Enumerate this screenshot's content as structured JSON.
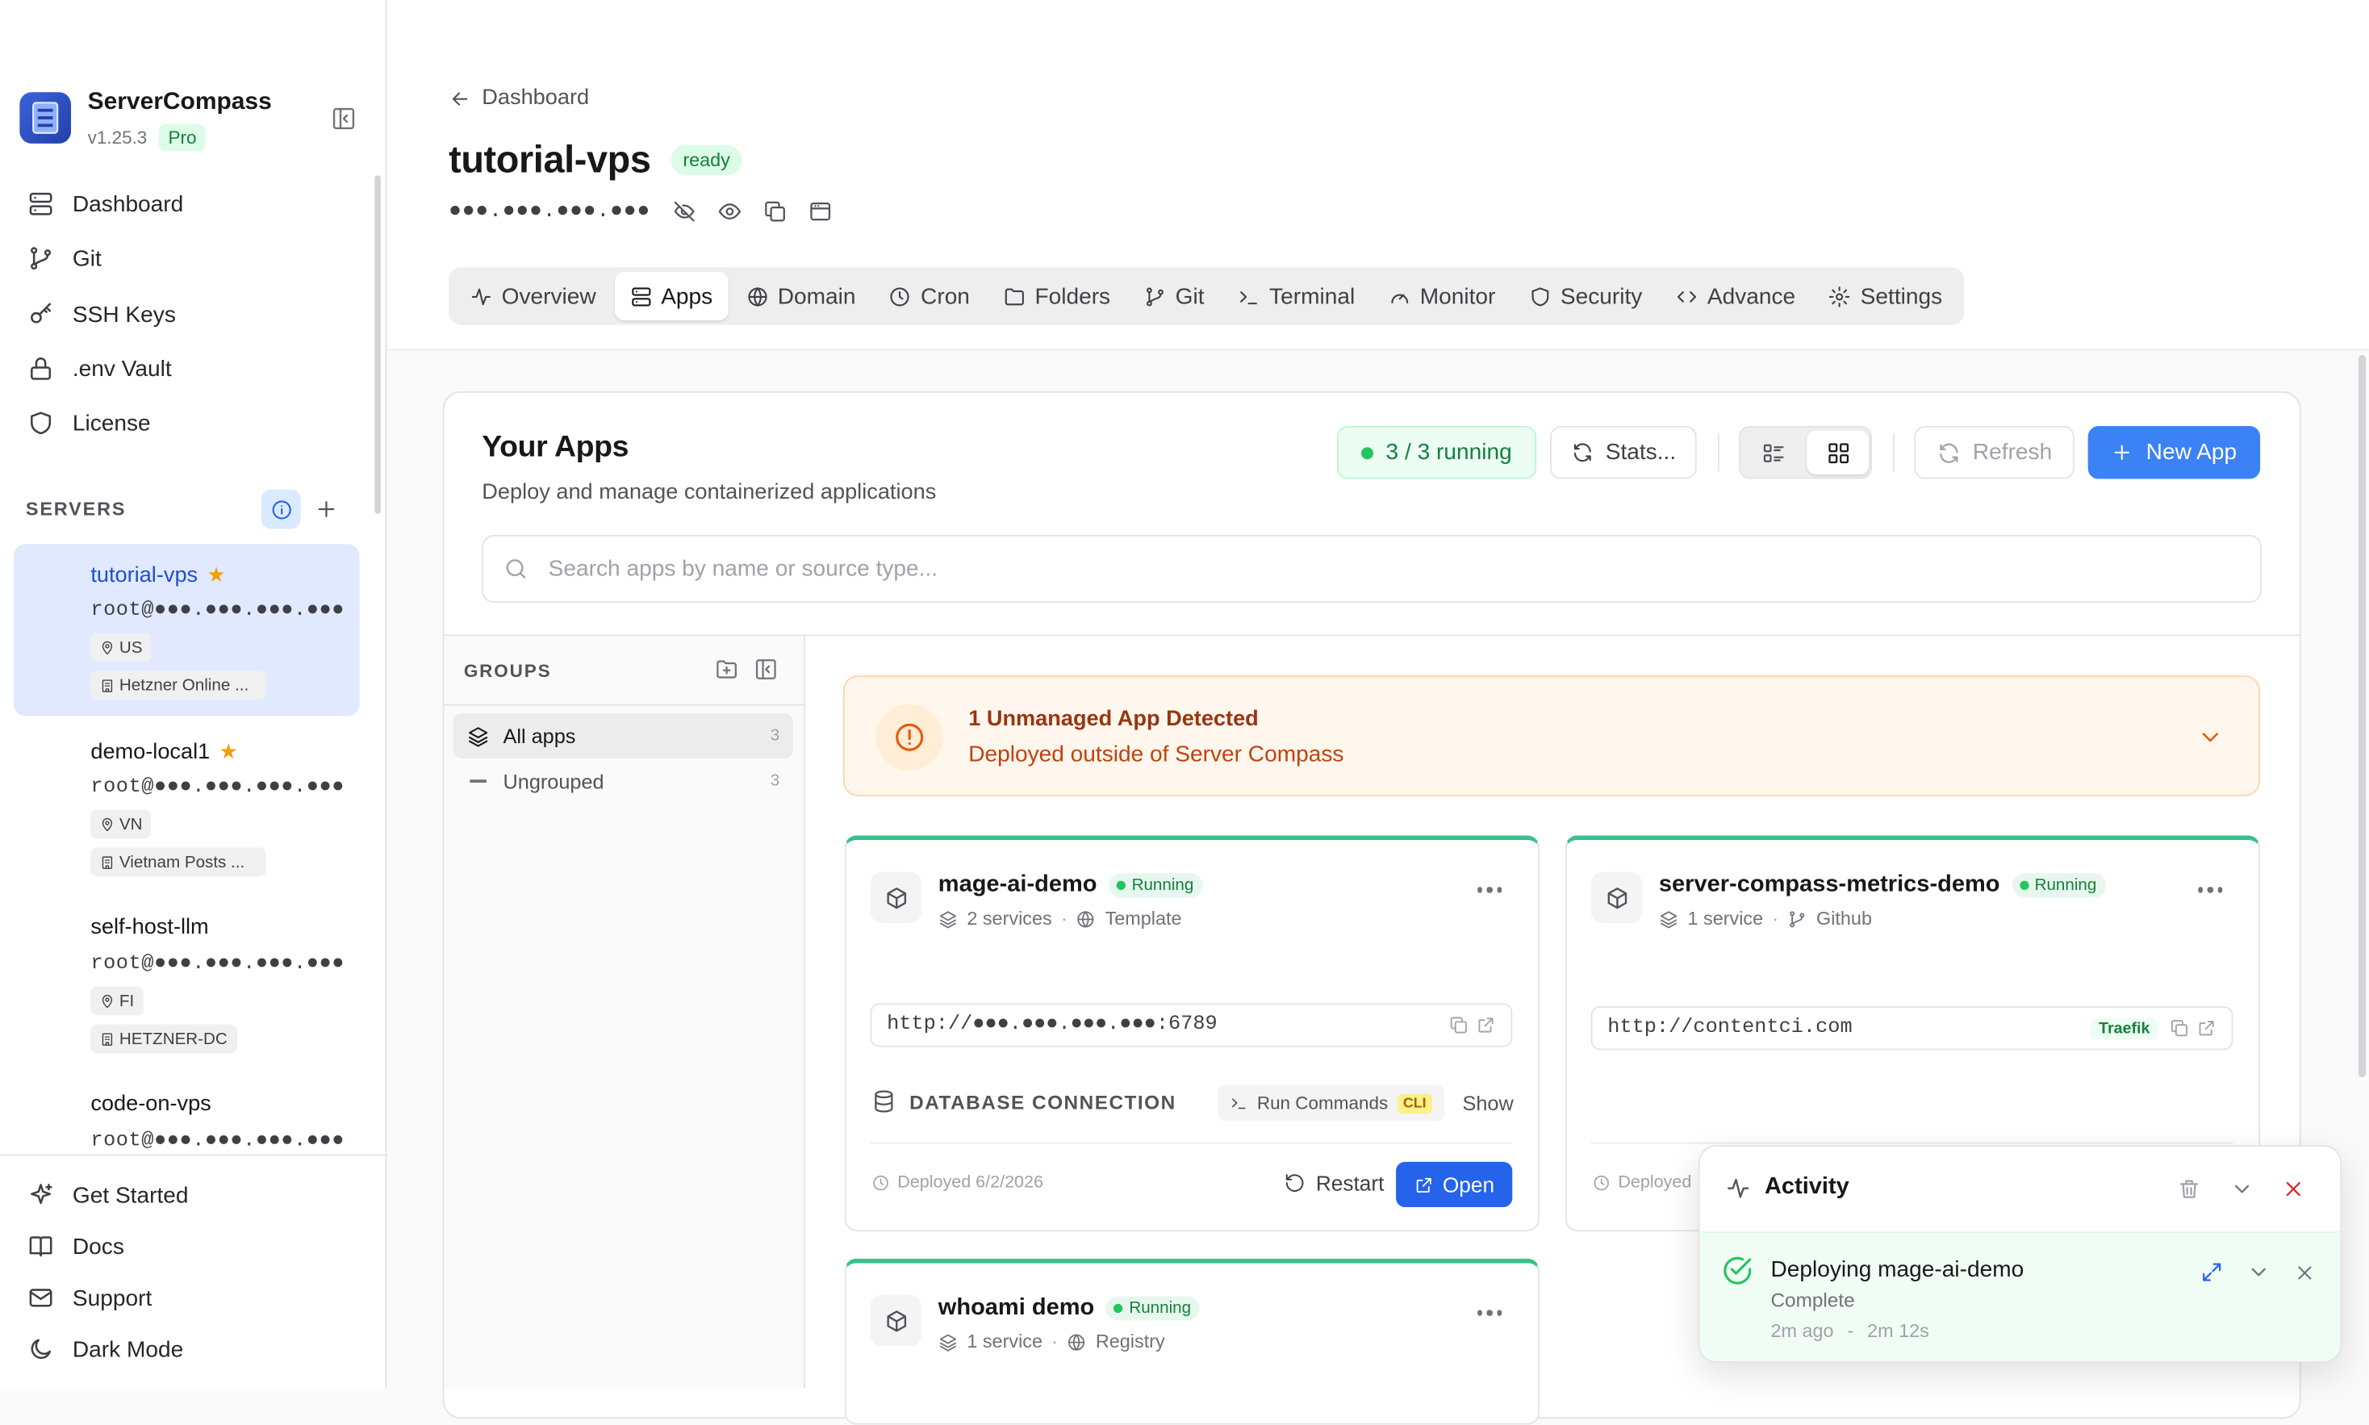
{
  "app": {
    "name": "ServerCompass",
    "version": "v1.25.3",
    "plan": "Pro"
  },
  "nav": [
    {
      "label": "Dashboard",
      "icon": "server-icon"
    },
    {
      "label": "Git",
      "icon": "git-branch-icon"
    },
    {
      "label": "SSH Keys",
      "icon": "key-icon"
    },
    {
      "label": ".env Vault",
      "icon": "lock-icon"
    },
    {
      "label": "License",
      "icon": "shield-icon"
    }
  ],
  "servers_heading": "SERVERS",
  "servers": [
    {
      "name": "tutorial-vps",
      "starred": true,
      "login": "root@●●●.●●●.●●●.●●●",
      "region": "US",
      "provider": "Hetzner Online ..."
    },
    {
      "name": "demo-local1",
      "starred": true,
      "login": "root@●●●.●●●.●●●.●●●",
      "region": "VN",
      "provider": "Vietnam Posts ..."
    },
    {
      "name": "self-host-llm",
      "starred": false,
      "login": "root@●●●.●●●.●●●.●●●",
      "region": "FI",
      "provider": "HETZNER-DC"
    },
    {
      "name": "code-on-vps",
      "starred": false,
      "login": "root@●●●.●●●.●●●.●●●"
    }
  ],
  "footer_nav": [
    {
      "label": "Get Started",
      "icon": "sparkle-icon"
    },
    {
      "label": "Docs",
      "icon": "book-icon"
    },
    {
      "label": "Support",
      "icon": "mail-icon"
    },
    {
      "label": "Dark Mode",
      "icon": "moon-icon"
    }
  ],
  "header": {
    "back": "Dashboard",
    "title": "tutorial-vps",
    "status": "ready",
    "ip": "●●●.●●●.●●●.●●●"
  },
  "tabs": [
    {
      "label": "Overview",
      "icon": "activity-icon"
    },
    {
      "label": "Apps",
      "icon": "server-icon",
      "active": true
    },
    {
      "label": "Domain",
      "icon": "globe-icon"
    },
    {
      "label": "Cron",
      "icon": "clock-icon"
    },
    {
      "label": "Folders",
      "icon": "folder-icon"
    },
    {
      "label": "Git",
      "icon": "git-branch-icon"
    },
    {
      "label": "Terminal",
      "icon": "terminal-icon"
    },
    {
      "label": "Monitor",
      "icon": "gauge-icon"
    },
    {
      "label": "Security",
      "icon": "shield-icon"
    },
    {
      "label": "Advance",
      "icon": "code-icon"
    },
    {
      "label": "Settings",
      "icon": "gear-icon"
    }
  ],
  "apps_panel": {
    "title": "Your Apps",
    "subtitle": "Deploy and manage containerized applications",
    "running": "3 / 3 running",
    "stats": "Stats...",
    "refresh": "Refresh",
    "new_app": "New App",
    "search_placeholder": "Search apps by name or source type..."
  },
  "groups": {
    "heading": "GROUPS",
    "items": [
      {
        "label": "All apps",
        "count": "3"
      },
      {
        "label": "Ungrouped",
        "count": "3"
      }
    ]
  },
  "alert": {
    "title": "1 Unmanaged App Detected",
    "subtitle": "Deployed outside of Server Compass"
  },
  "apps": [
    {
      "name": "mage-ai-demo",
      "status": "Running",
      "services": "2 services",
      "source": "Template",
      "url": "http://●●●.●●●.●●●.●●●:6789",
      "db_label": "DATABASE CONNECTION",
      "run_commands": "Run Commands",
      "cli": "CLI",
      "show": "Show",
      "deployed": "Deployed 6/2/2026",
      "restart": "Restart",
      "open": "Open"
    },
    {
      "name": "server-compass-metrics-demo",
      "status": "Running",
      "services": "1 service",
      "source": "Github",
      "url": "http://contentci.com",
      "proxy": "Traefik",
      "deployed": "Deployed"
    },
    {
      "name": "whoami demo",
      "status": "Running",
      "services": "1 service",
      "source": "Registry"
    }
  ],
  "activity": {
    "title": "Activity",
    "task": "Deploying mage-ai-demo",
    "state": "Complete",
    "ago": "2m ago",
    "sep": "-",
    "duration": "2m 12s"
  },
  "colors": {
    "accent": "#3b82f6",
    "running": "#22c55e",
    "alert_bg": "#fff7ed",
    "alert_text": "#c2410c",
    "star": "#f59e0b"
  }
}
